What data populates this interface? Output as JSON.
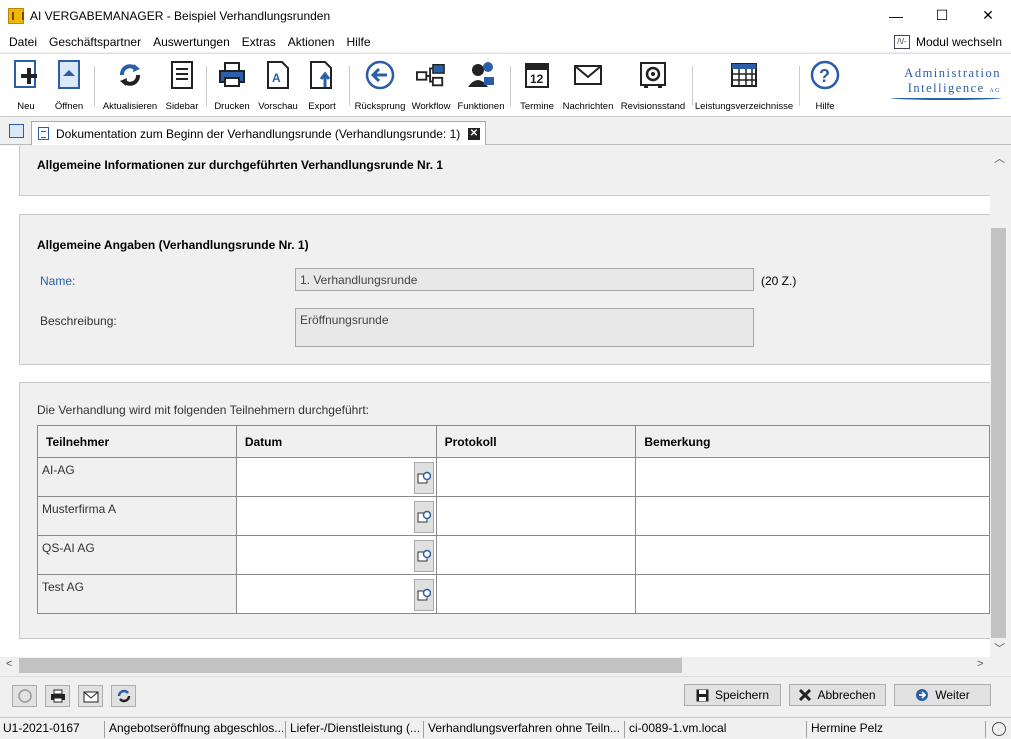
{
  "window": {
    "title": "AI VERGABEMANAGER - Beispiel Verhandlungsrunden",
    "minimize": "—",
    "maximize": "☐",
    "close": "✕"
  },
  "menu": {
    "items": [
      "Datei",
      "Geschäftspartner",
      "Auswertungen",
      "Extras",
      "Aktionen",
      "Hilfe"
    ],
    "modul_wechseln": "Modul wechseln"
  },
  "toolbar": {
    "buttons": [
      "Neu",
      "Öffnen",
      "Aktualisieren",
      "Sidebar",
      "Drucken",
      "Vorschau",
      "Export",
      "Rücksprung",
      "Workflow",
      "Funktionen",
      "Termine",
      "Nachrichten",
      "Revisionsstand",
      "Leistungsverzeichnisse",
      "Hilfe"
    ],
    "calendar_day": "12"
  },
  "logo": {
    "line1": "Administration",
    "line2": "Intelligence",
    "suffix": "AG"
  },
  "tab": {
    "title": "Dokumentation zum Beginn der Verhandlungsrunde (Verhandlungsrunde: 1)"
  },
  "form": {
    "section1_title": "Allgemeine Informationen zur durchgeführten Verhandlungsrunde Nr. 1",
    "section2_title": "Allgemeine Angaben (Verhandlungsrunde Nr. 1)",
    "name_label": "Name:",
    "name_value": "1. Verhandlungsrunde",
    "name_hint": "(20 Z.)",
    "beschreibung_label": "Beschreibung:",
    "beschreibung_value": "Eröffnungsrunde",
    "participants_intro": "Die Verhandlung wird mit folgenden Teilnehmern durchgeführt:"
  },
  "table": {
    "columns": [
      "Teilnehmer",
      "Datum",
      "Protokoll",
      "Bemerkung"
    ],
    "rows": [
      {
        "teilnehmer": "AI-AG",
        "datum": "",
        "protokoll": "",
        "bemerkung": ""
      },
      {
        "teilnehmer": "Musterfirma A",
        "datum": "",
        "protokoll": "",
        "bemerkung": ""
      },
      {
        "teilnehmer": "QS-AI AG",
        "datum": "",
        "protokoll": "",
        "bemerkung": ""
      },
      {
        "teilnehmer": "Test AG",
        "datum": "",
        "protokoll": "",
        "bemerkung": ""
      }
    ]
  },
  "actions": {
    "speichern": "Speichern",
    "abbrechen": "Abbrechen",
    "weiter": "Weiter"
  },
  "status": {
    "id": "U1-2021-0167",
    "phase": "Angebotseröffnung abgeschlos...",
    "type": "Liefer-/Dienstleistung (...",
    "verfahren": "Verhandlungsverfahren ohne Teiln...",
    "server": "ci-0089-1.vm.local",
    "user": "Hermine Pelz"
  },
  "colors": {
    "accent": "#2a5ea8",
    "toolbar_icon": "#2a5ea8"
  }
}
